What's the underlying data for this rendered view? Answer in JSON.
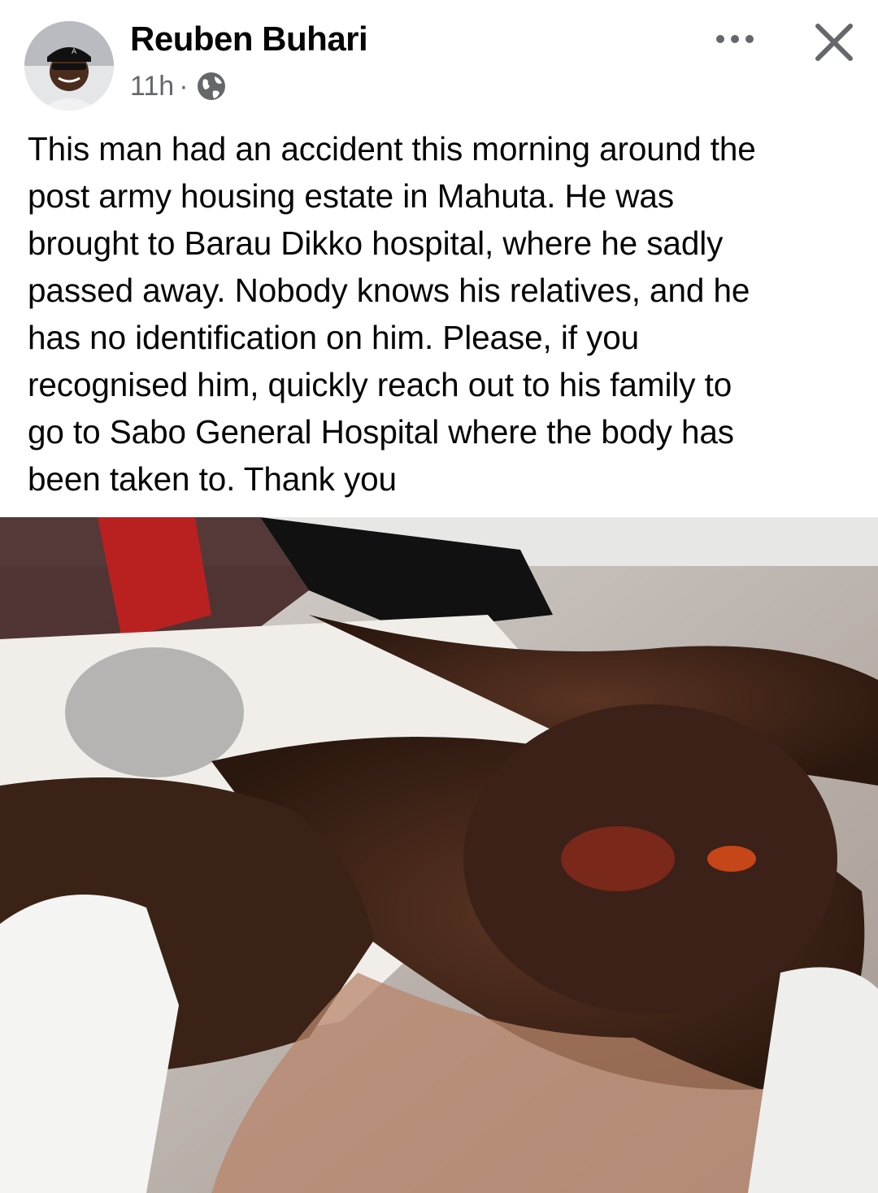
{
  "post": {
    "author": {
      "name": "Reuben Buhari",
      "avatar_icon": "profile-photo"
    },
    "timestamp": "11h",
    "separator": "·",
    "audience_icon": "globe-icon",
    "actions": {
      "more_icon": "more-horizontal-icon",
      "close_icon": "close-icon"
    },
    "text_lines": [
      "This man had an accident this morning around the",
      "post army housing estate in Mahuta. He was",
      "brought to Barau Dikko hospital, where he sadly",
      "passed away. Nobody knows his relatives, and he",
      "has no identification on him. Please, if you",
      "recognised him, quickly reach out to his family to",
      "go to Sabo General Hospital where the body has",
      "been taken to. Thank you"
    ],
    "photo": {
      "icon": "photo-image"
    }
  },
  "colors": {
    "text_primary": "#050505",
    "text_secondary": "#65676b",
    "background": "#ffffff"
  }
}
